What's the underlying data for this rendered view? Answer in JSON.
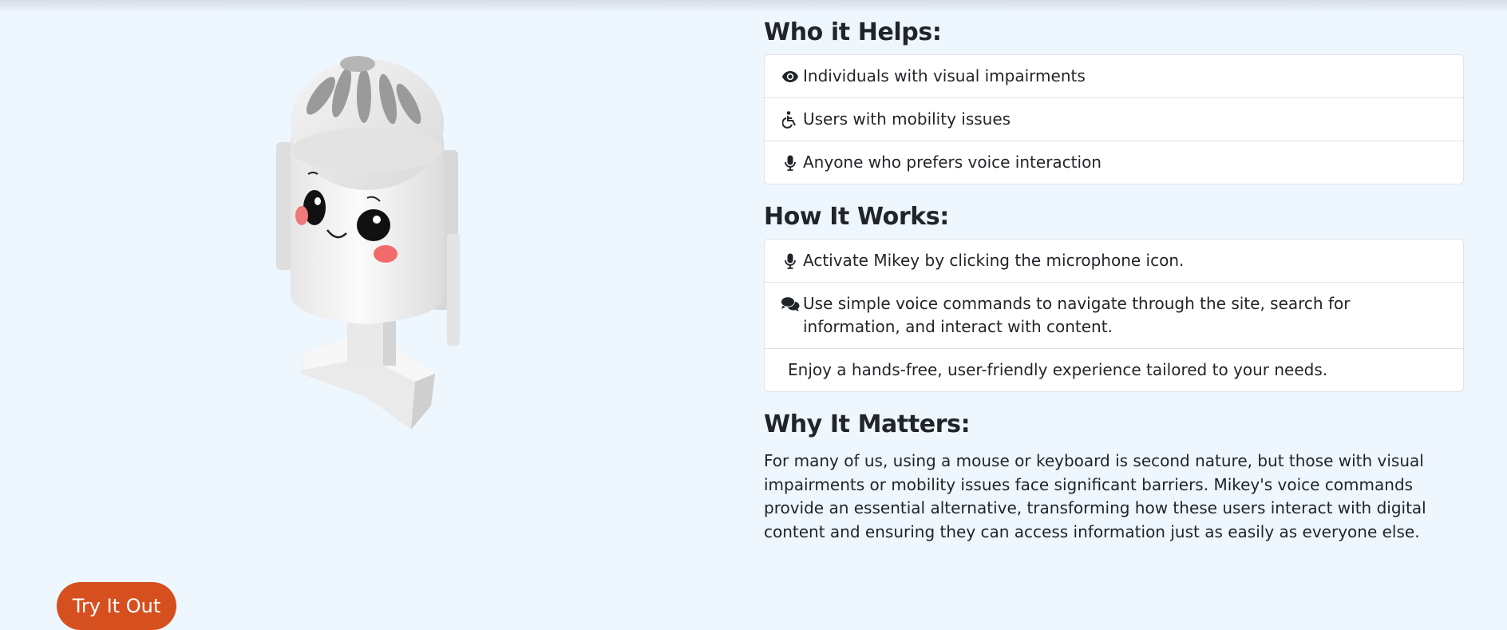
{
  "who": {
    "heading": "Who it Helps:",
    "items": [
      {
        "icon": "eye-icon",
        "text": "Individuals with visual impairments"
      },
      {
        "icon": "wheelchair-icon",
        "text": "Users with mobility issues"
      },
      {
        "icon": "microphone-icon",
        "text": "Anyone who prefers voice interaction"
      }
    ]
  },
  "how": {
    "heading": "How It Works:",
    "items": [
      {
        "icon": "microphone-icon",
        "text": "Activate Mikey by clicking the microphone icon."
      },
      {
        "icon": "comments-icon",
        "text": "Use simple voice commands to navigate through the site, search for information, and interact with content."
      },
      {
        "icon": "",
        "text": "Enjoy a hands-free, user-friendly experience tailored to your needs."
      }
    ]
  },
  "why": {
    "heading": "Why It Matters:",
    "text": "For many of us, using a mouse or keyboard is second nature, but those with visual impairments or mobility issues face significant barriers. Mikey's voice commands provide an essential alternative, transforming how these users interact with digital content and ensuring they can access information just as easily as everyone else."
  },
  "cta": {
    "label": "Try It Out",
    "color": "#d64f1e"
  },
  "page": {
    "background": "#eef6fe"
  }
}
